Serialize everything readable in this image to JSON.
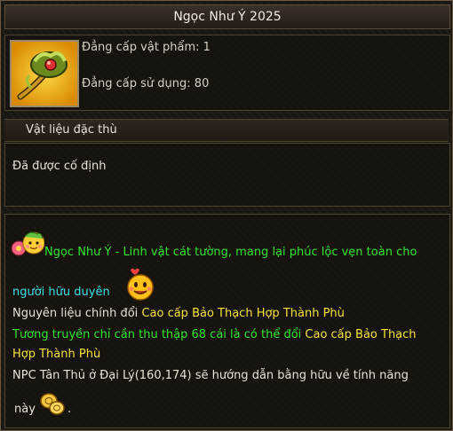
{
  "title": "Ngọc Như Ý 2025",
  "item": {
    "icon": "golden-ruyi-scepter-icon",
    "item_level": "Đẳng cấp vật phẩm: 1",
    "use_level": "Đẳng cấp sử dụng: 80"
  },
  "materials": {
    "header": "Vật liệu đặc thù",
    "status": "Đã được cố định"
  },
  "description": {
    "line1": "Ngọc Như Ý - Linh vật cát tường, mang lại phúc lộc vẹn toàn cho",
    "line2": "người hữu duyên",
    "line3_prefix": "Nguyên liệu chính đổi ",
    "line3_item": "Cao cấp Bảo Thạch Hợp Thành Phù",
    "line4_prefix": "Tương truyền chỉ cần thu thập 68 cái là có thể đổi ",
    "line4_item": "Cao cấp Bảo Thạch",
    "line5": "Hợp Thành Phù",
    "line6": "NPC Tân Thủ ở Đại Lý(160,174) sẽ hướng dẫn bằng hữu về tính năng",
    "line7_prefix": "này",
    "line7_suffix": "."
  },
  "colors": {
    "green": "#2fe62f",
    "cyan": "#38e0e8",
    "yellow": "#f5e23a"
  }
}
